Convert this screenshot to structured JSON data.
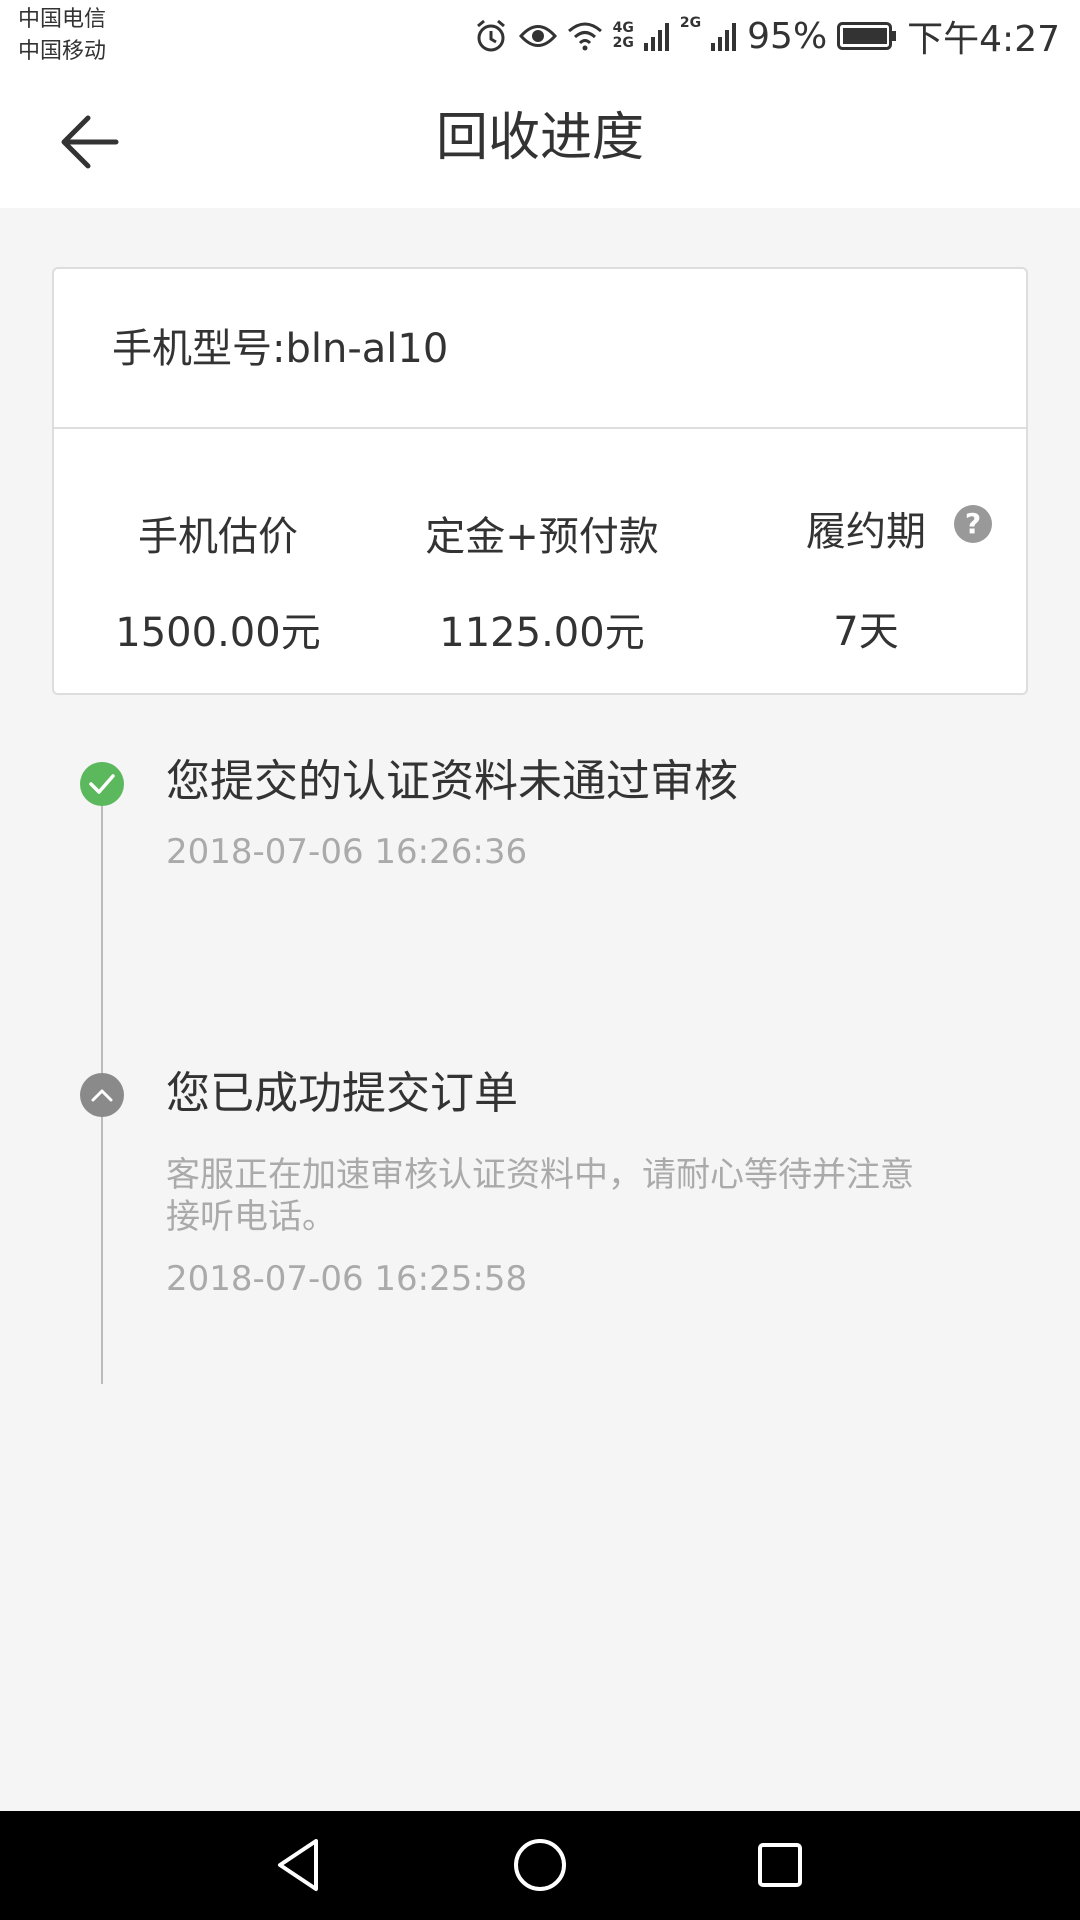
{
  "status_bar": {
    "carrier1": "中国电信",
    "carrier2": "中国移动",
    "net1_top": "4G",
    "net1_bottom": "2G",
    "net2": "2G",
    "battery": "95%",
    "time": "下午4:27"
  },
  "header": {
    "title": "回收进度",
    "back_icon": "arrow-left-icon"
  },
  "card": {
    "model": "手机型号:bln-al10",
    "columns": [
      {
        "label": "手机估价",
        "value": "1500.00元"
      },
      {
        "label": "定金+预付款",
        "value": "1125.00元"
      },
      {
        "label": "履约期",
        "value": "7天"
      }
    ],
    "help_glyph": "?"
  },
  "timeline": [
    {
      "title": "您提交的认证资料未通过审核",
      "time": "2018-07-06 16:26:36",
      "icon": "check-icon",
      "color": "#5cb85c"
    },
    {
      "title": "您已成功提交订单",
      "desc": "客服正在加速审核认证资料中，请耐心等待并注意接听电话。",
      "time": "2018-07-06 16:25:58",
      "icon": "chevron-up-icon",
      "color": "#8a8a8a"
    }
  ],
  "colors": {
    "accent_green": "#5cb85c",
    "secondary_text": "#aaaaaa",
    "background": "#f5f5f5"
  }
}
